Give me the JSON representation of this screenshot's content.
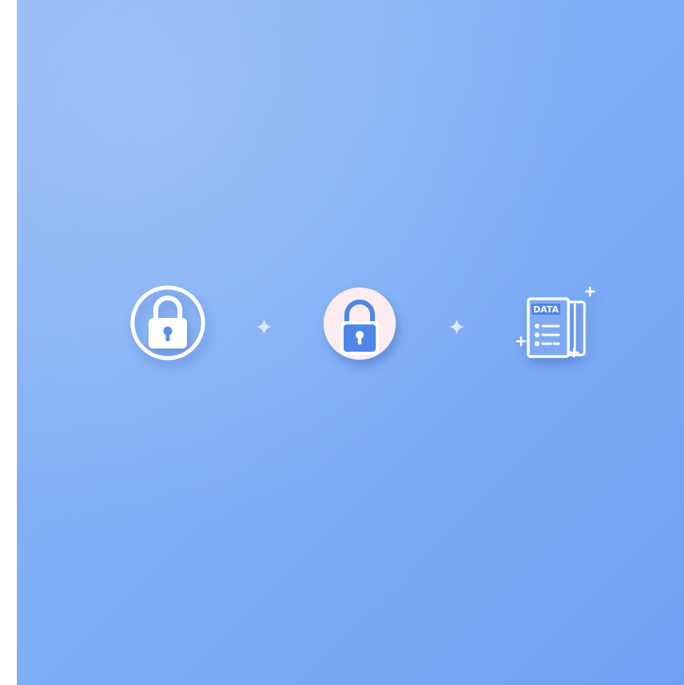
{
  "background": {
    "gradient_start": "#8db6f6",
    "gradient_end": "#6f9ff1"
  },
  "icons": [
    {
      "name": "lock-circle-outline-icon",
      "color": "#ffffff"
    },
    {
      "name": "sparkle-icon",
      "color": "#dbe8ff"
    },
    {
      "name": "lock-circle-filled-icon",
      "color": "#fbecf0",
      "lock_color": "#4f86e8"
    },
    {
      "name": "sparkle-icon",
      "color": "#dbe8ff"
    },
    {
      "name": "data-document-icon",
      "color": "#ffffff"
    }
  ],
  "document": {
    "header_text": "DATA"
  }
}
